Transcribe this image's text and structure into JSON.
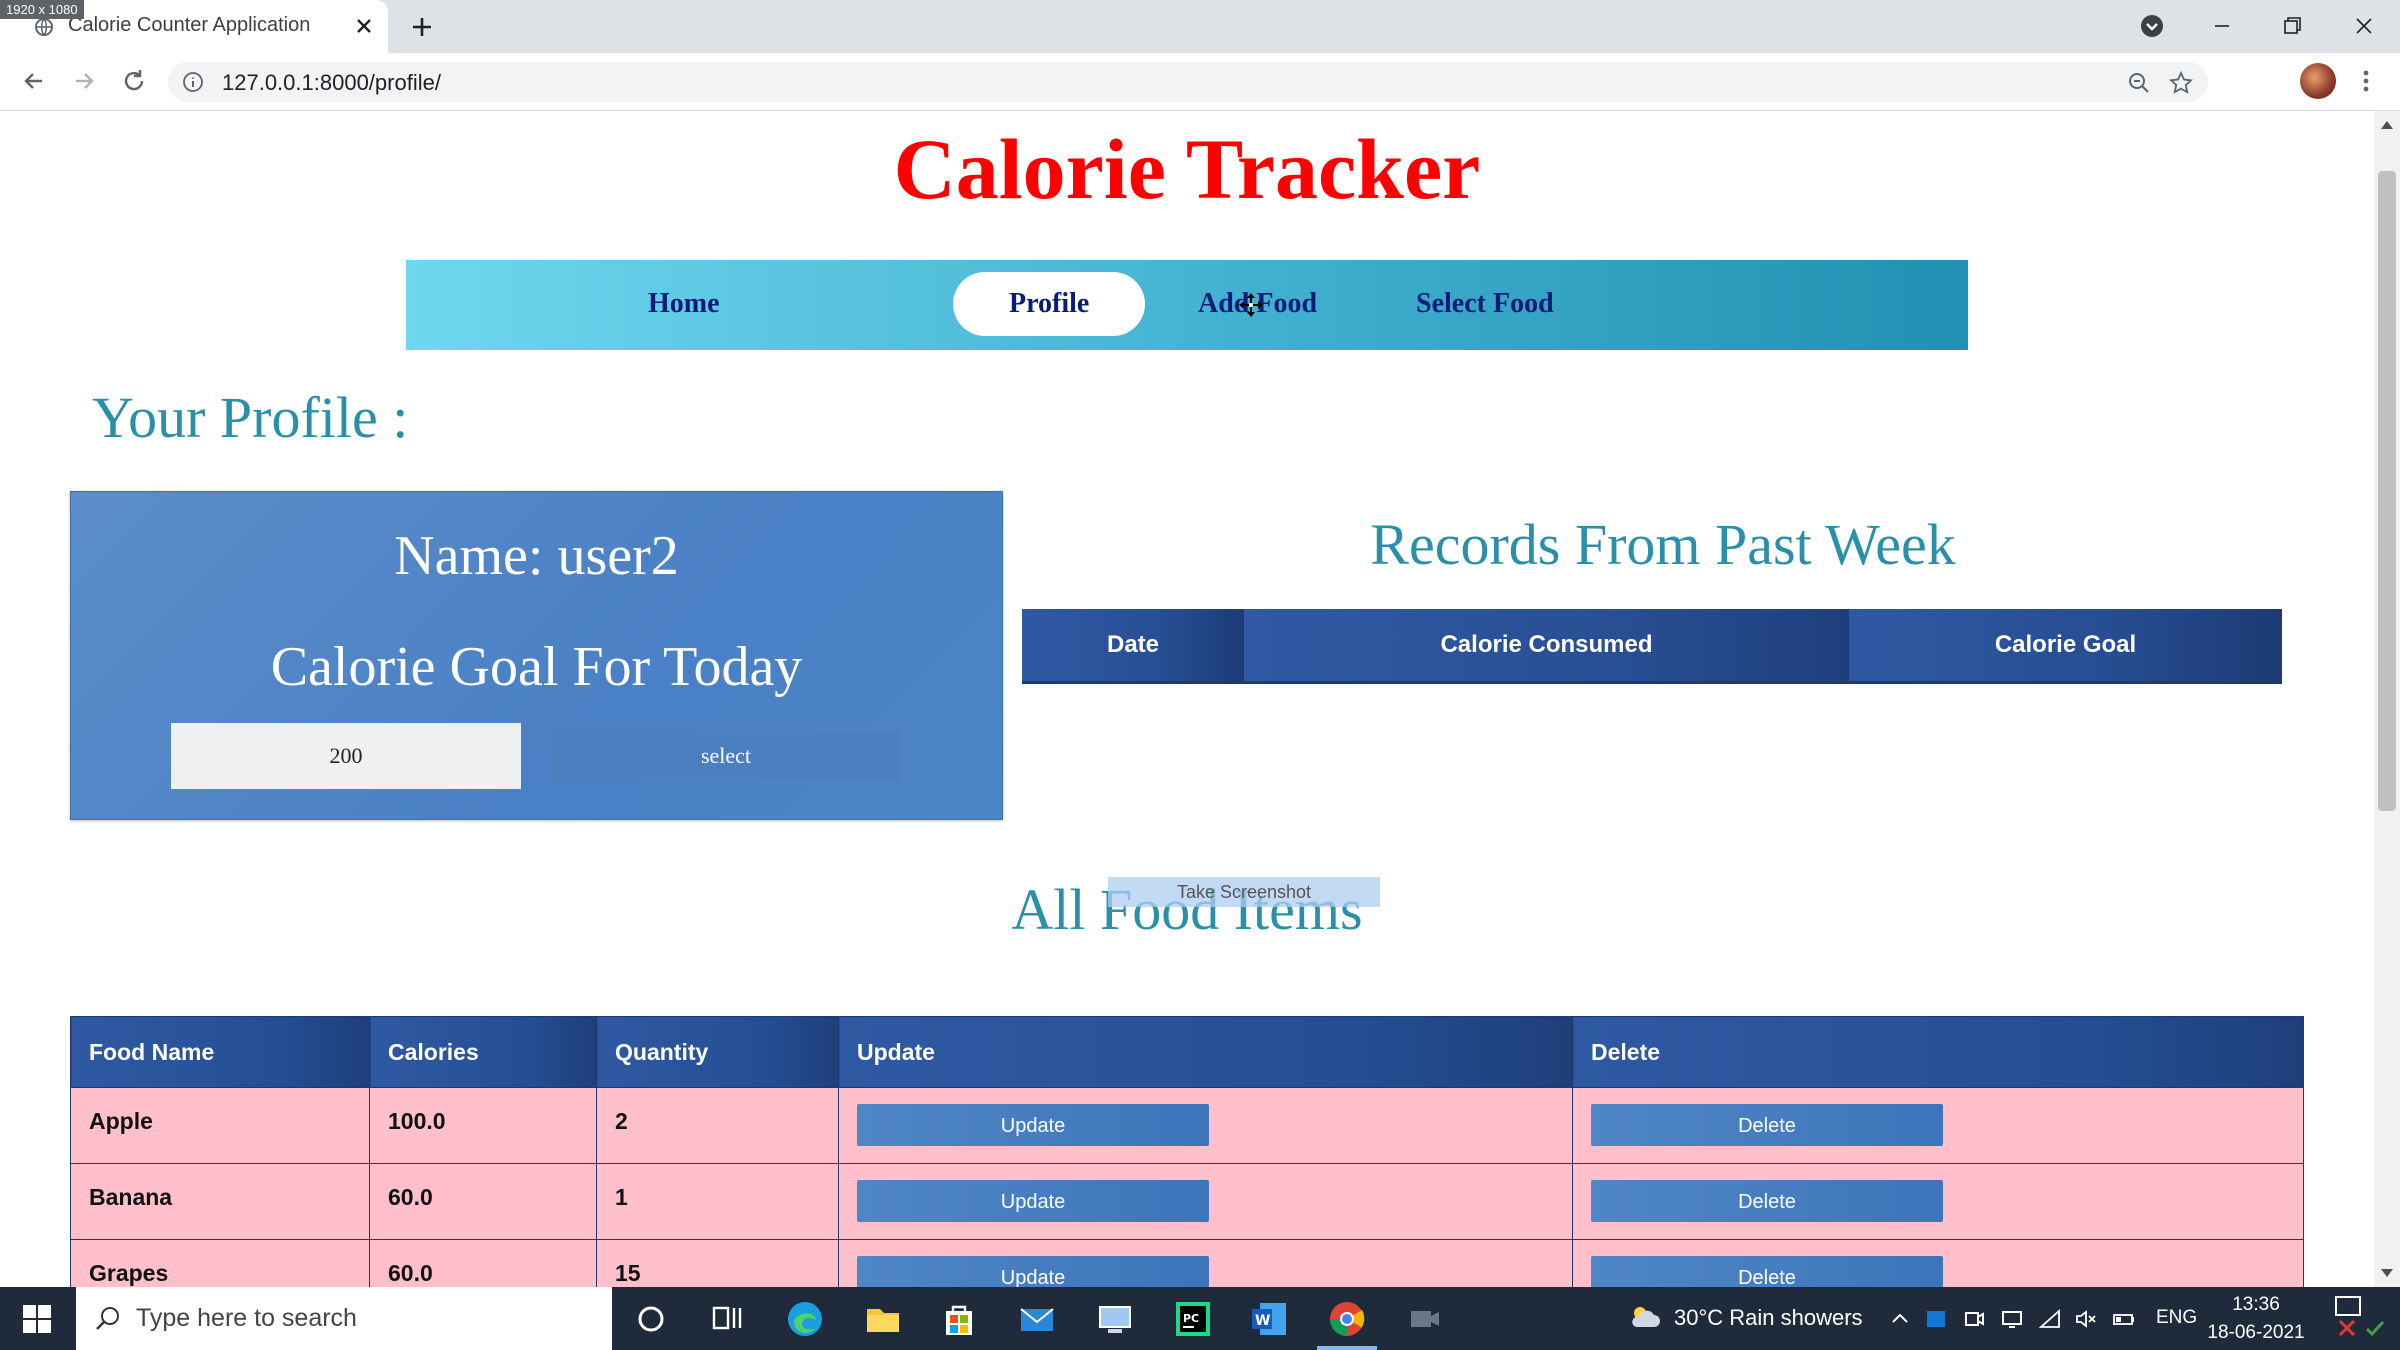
{
  "browser": {
    "resolution_badge": "1920 x 1080",
    "tab_title": "Calorie Counter Application",
    "url": "127.0.0.1:8000/profile/"
  },
  "page": {
    "title": "Calorie Tracker",
    "nav": [
      "Home",
      "Profile",
      "Add Food",
      "Select Food"
    ],
    "active_nav": "Profile",
    "profile_heading": "Your Profile :",
    "profile": {
      "name_label": "Name: user2",
      "goal_label": "Calorie Goal For Today",
      "goal_value": "200",
      "select_label": "select"
    },
    "records": {
      "heading": "Records From Past Week",
      "columns": [
        "Date",
        "Calorie Consumed",
        "Calorie Goal"
      ]
    },
    "screenshot_overlay": "Take Screenshot",
    "food": {
      "heading": "All Food Items",
      "columns": [
        "Food Name",
        "Calories",
        "Quantity",
        "Update",
        "Delete"
      ],
      "rows": [
        {
          "name": "Apple",
          "calories": "100.0",
          "quantity": "2",
          "update": "Update",
          "delete": "Delete"
        },
        {
          "name": "Banana",
          "calories": "60.0",
          "quantity": "1",
          "update": "Update",
          "delete": "Delete"
        },
        {
          "name": "Grapes",
          "calories": "60.0",
          "quantity": "15",
          "update": "Update",
          "delete": "Delete"
        }
      ]
    }
  },
  "taskbar": {
    "search_placeholder": "Type here to search",
    "weather": "30°C  Rain showers",
    "language": "ENG",
    "time": "13:36",
    "date": "18-06-2021"
  },
  "colors": {
    "title": "#ff0000",
    "heading": "#2a8fa8",
    "nav_text": "#0b1b7a",
    "table_header": "#244e94",
    "table_row": "#ffc0cb",
    "button": "#4a7fc0"
  }
}
